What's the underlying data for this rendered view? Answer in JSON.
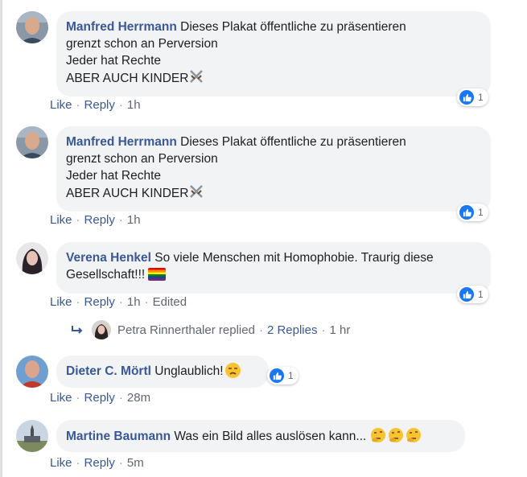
{
  "comments": [
    {
      "author": "Manfred Herrmann",
      "lines": [
        "Dieses Plakat öffentliche zu präsentieren",
        "grenzt schon an Perversion",
        "Jeder hat Rechte",
        "ABER AUCH KINDER"
      ],
      "like_label": "Like",
      "reply_label": "Reply",
      "time": "1h",
      "reactions": "1"
    },
    {
      "author": "Manfred Herrmann",
      "lines": [
        "Dieses Plakat öffentliche zu präsentieren",
        "grenzt schon an Perversion",
        "Jeder hat Rechte",
        "ABER AUCH KINDER"
      ],
      "like_label": "Like",
      "reply_label": "Reply",
      "time": "1h",
      "reactions": "1"
    },
    {
      "author": "Verena Henkel",
      "lines": [
        "So viele Menschen mit Homophobie. Traurig diese",
        "Gesellschaft!!!"
      ],
      "like_label": "Like",
      "reply_label": "Reply",
      "time": "1h",
      "edited": "Edited",
      "reactions": "1"
    },
    {
      "author": "Dieter C. Mörtl",
      "lines": [
        "Unglaublich!"
      ],
      "like_label": "Like",
      "reply_label": "Reply",
      "time": "28m",
      "reactions": "1"
    },
    {
      "author": "Martine Baumann",
      "lines": [
        "Was ein Bild alles auslösen kann..."
      ],
      "like_label": "Like",
      "reply_label": "Reply",
      "time": "5m"
    }
  ],
  "reply_summary": {
    "name": "Petra Rinnerthaler",
    "action": "replied",
    "count": "2 Replies",
    "time": "1 hr"
  },
  "separator": "·",
  "colors": {
    "author_blue": "#385898",
    "bubble_bg": "#f2f3f5",
    "like_blue": "#1877f2",
    "meta_gray": "#606770"
  },
  "icons": [
    "crossed-swords-icon",
    "rainbow-flag-icon",
    "unamused-face-icon",
    "thinking-face-icon",
    "reply-arrow-icon",
    "like-reaction-icon"
  ]
}
